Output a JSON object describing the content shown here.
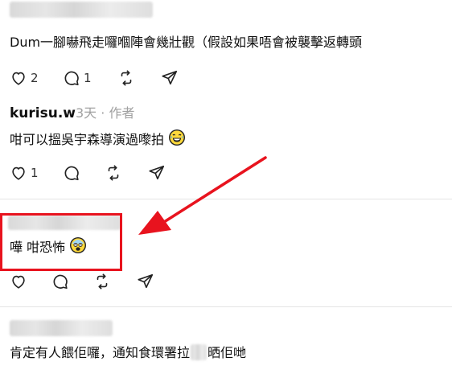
{
  "comments": [
    {
      "text": "Dum一腳嚇飛走囉嗰陣會幾壯觀（假設如果唔會被襲擊返轉頭",
      "likes": "2",
      "replies": "1"
    },
    {
      "author": "kurisu.w",
      "time": "3天",
      "separator": "·",
      "role": "作者",
      "text": "咁可以搵吳宇森導演過嚟拍",
      "emoji": "grinning-sweat-laughing",
      "likes": "1"
    },
    {
      "text": "嘩 咁恐怖",
      "emoji": "shocked-face"
    },
    {
      "text": "肯定有人餵佢囉，通知食環署拉",
      "text_after": "晒佢哋"
    }
  ],
  "annotation": {
    "box_color": "#e8131e",
    "arrow_color": "#e8131e"
  },
  "icons": [
    "heart-icon",
    "reply-icon",
    "repost-icon",
    "share-icon"
  ]
}
